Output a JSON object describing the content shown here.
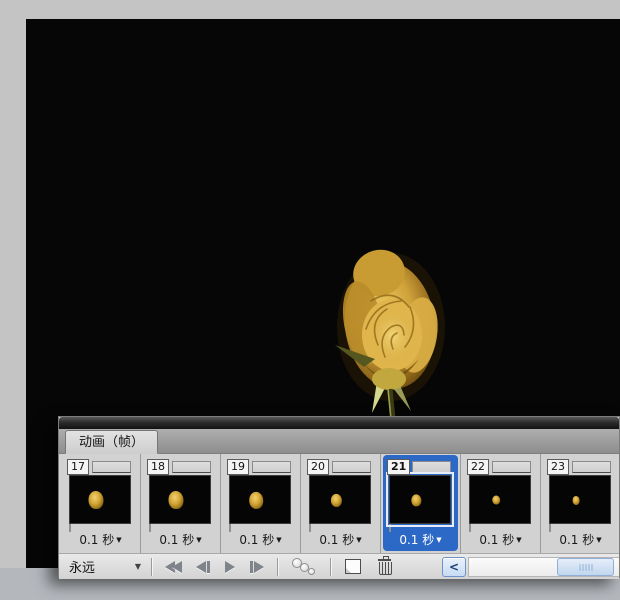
{
  "workspace": {
    "colors": {
      "surround_gray": "#c4c4c4",
      "canvas_black": "#060606",
      "bottom_gray": "#b4b8bd"
    }
  },
  "canvas": {
    "subject_icon": "yellow-rose-photo",
    "rose_colors": {
      "petal_light": "#f0d070",
      "petal_mid": "#d0a63c",
      "petal_dark": "#8a6218",
      "sepal_green": "#c8cc82",
      "stem_dark": "#3c3f14"
    }
  },
  "panel": {
    "title_tab": "动画（帧）",
    "colors": {
      "selection_blue": "#2c68c6",
      "panel_bg": "#d4d4d4"
    },
    "delay_arrow": "▼",
    "frames": [
      {
        "number": "17",
        "delay": "0.1 秒",
        "selected": false,
        "rose_scale": 1
      },
      {
        "number": "18",
        "delay": "0.1 秒",
        "selected": false,
        "rose_scale": 1
      },
      {
        "number": "19",
        "delay": "0.1 秒",
        "selected": false,
        "rose_scale": 0.9
      },
      {
        "number": "20",
        "delay": "0.1 秒",
        "selected": false,
        "rose_scale": 0.68
      },
      {
        "number": "21",
        "delay": "0.1 秒",
        "selected": true,
        "rose_scale": 0.62
      },
      {
        "number": "22",
        "delay": "0.1 秒",
        "selected": false,
        "rose_scale": 0.5
      },
      {
        "number": "23",
        "delay": "0.1 秒",
        "selected": false,
        "rose_scale": 0.45
      }
    ],
    "toolbar": {
      "loop_label": "永远",
      "loop_arrow": "▼",
      "button_icons": [
        "double-left-triangle-icon",
        "left-triangle-bar-icon",
        "right-triangle-icon",
        "bar-right-triangle-icon",
        "tween-dots-icon",
        "new-page-icon",
        "trash-icon"
      ],
      "scrollbar": {
        "left_arrow_glyph": "<"
      }
    }
  }
}
